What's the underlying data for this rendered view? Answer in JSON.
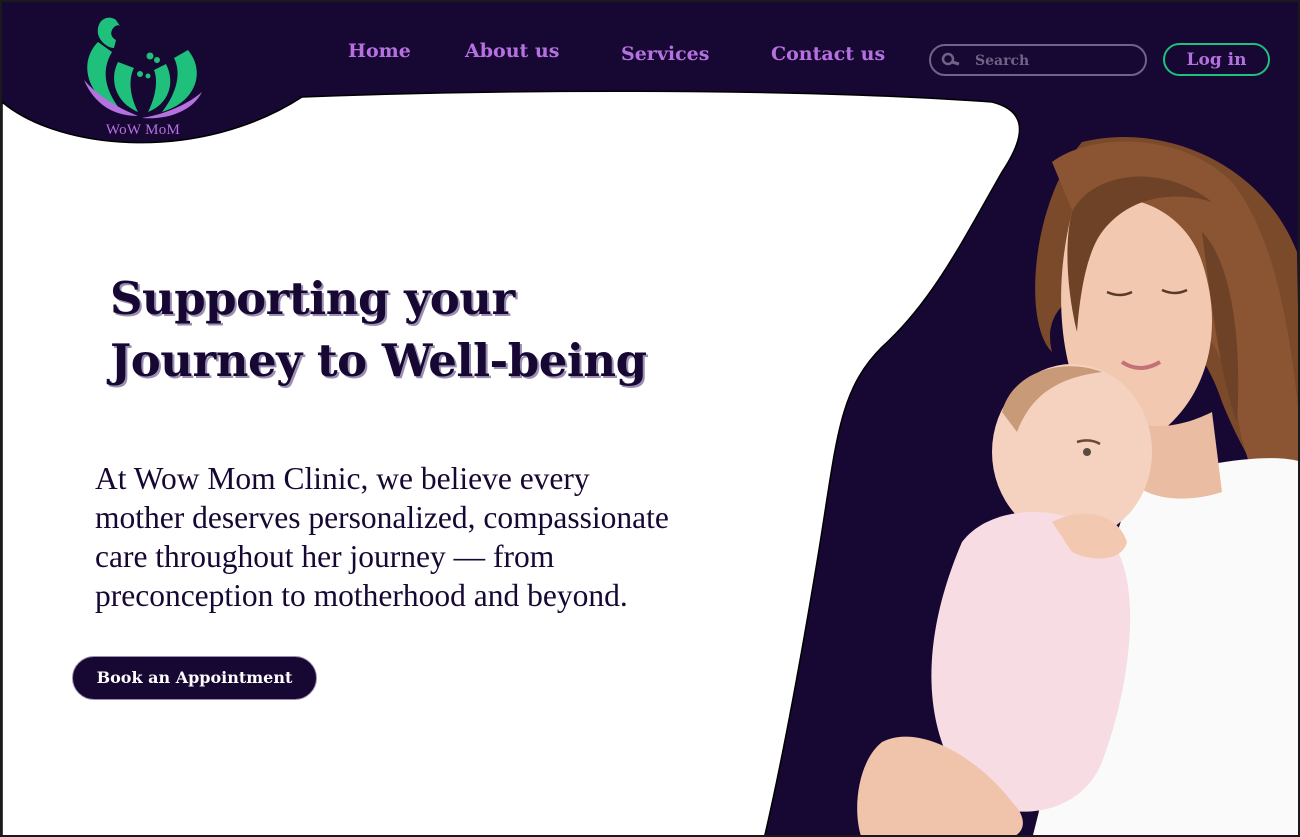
{
  "brand": {
    "name": "WoW MoM",
    "colors": {
      "navy": "#170733",
      "purple": "#b671e0",
      "green": "#1ec07b",
      "white": "#ffffff"
    }
  },
  "nav": {
    "items": [
      {
        "label": "Home"
      },
      {
        "label": "About us"
      },
      {
        "label": "Services"
      },
      {
        "label": "Contact us"
      }
    ],
    "search": {
      "placeholder": "Search",
      "icon": "search-icon"
    },
    "login_label": "Log in"
  },
  "hero": {
    "title_lines": [
      "Supporting your",
      "Journey to Well-being"
    ],
    "body_lines": [
      "At Wow Mom Clinic, we believe every",
      "mother deserves personalized, compassionate",
      "care throughout her journey — from",
      "preconception to motherhood and beyond."
    ],
    "cta_label": "Book an Appointment"
  }
}
